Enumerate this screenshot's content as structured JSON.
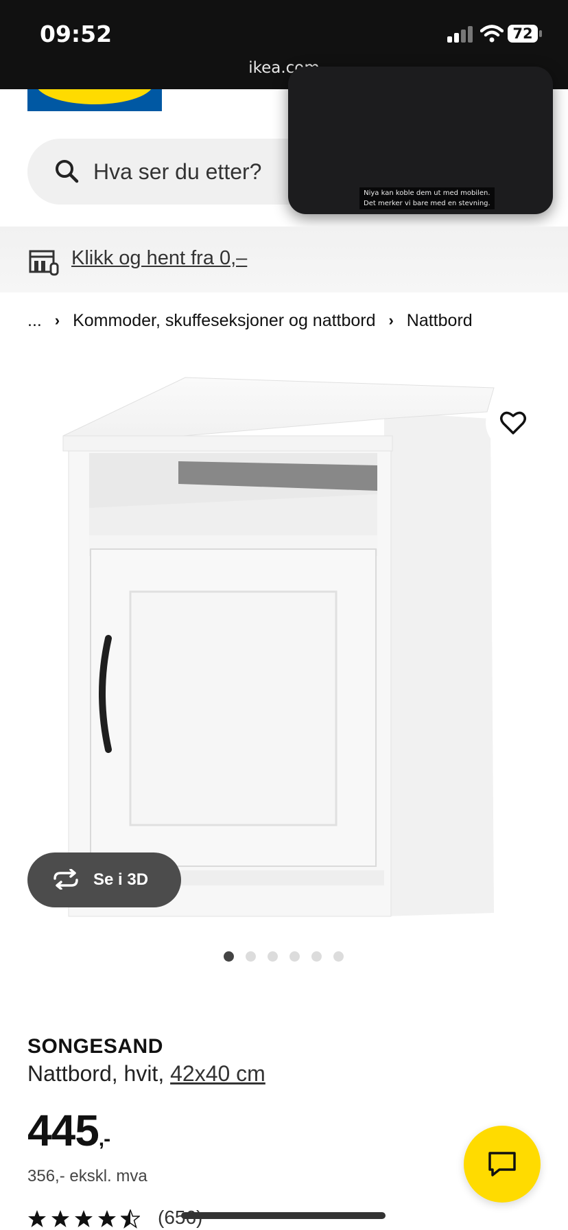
{
  "status_bar": {
    "time": "09:52",
    "battery": "72",
    "url": "ikea.com"
  },
  "search": {
    "placeholder": "Hva ser du etter?"
  },
  "video_overlay": {
    "caption_line1": "Niya kan koble dem ut med mobilen.",
    "caption_line2": "Det merker vi bare med en stevning."
  },
  "banner": {
    "link_text": "Klikk og hent fra 0,–"
  },
  "breadcrumb": {
    "ellipsis": "...",
    "items": [
      "Kommoder, skuffeseksjoner og nattbord",
      "Nattbord"
    ]
  },
  "gallery": {
    "view_3d_label": "Se i 3D",
    "image_count": 6,
    "active_index": 0
  },
  "product": {
    "name": "SONGESAND",
    "description": "Nattbord, hvit,",
    "size": "42x40 cm",
    "price": "445",
    "price_suffix": ",-",
    "price_ex_vat": "356,- ekskl. mva",
    "rating": 4.5,
    "review_count": "(656)"
  },
  "colors": {
    "brand_blue": "#0058a3",
    "brand_yellow": "#ffdb00",
    "status_bar_bg": "#111111"
  },
  "icons": [
    "search-icon",
    "store-icon",
    "heart-icon",
    "rotate-3d-icon",
    "chat-icon",
    "star-icon",
    "wifi-icon",
    "signal-icon",
    "battery-icon"
  ]
}
